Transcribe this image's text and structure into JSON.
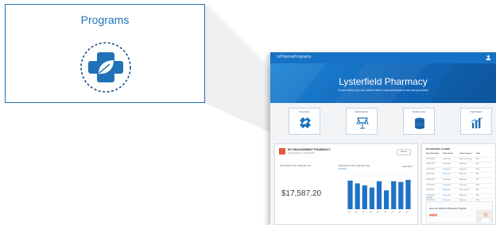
{
  "callout": {
    "title": "Programs",
    "icon": "programs-cross-icon"
  },
  "app": {
    "brand": "rxPharmaPrograms",
    "hero": {
      "title": "Lysterfield Pharmacy",
      "subtitle": "A place where you can submit claims, track performance and ask questions!"
    },
    "tiles": [
      {
        "label": "Programs",
        "icon": "programs-cross-icon"
      },
      {
        "label": "Medications",
        "icon": "scale-icon"
      },
      {
        "label": "Settlements",
        "icon": "coins-icon"
      },
      {
        "label": "Dashboard",
        "icon": "bar-chart-icon"
      }
    ],
    "pharmacy": {
      "name": "MY ENGAGEMENT PHARMACY",
      "address": "Lysterfield Rd, Lysterfield VIC",
      "button": "Details"
    },
    "stat": {
      "label": "Paid Claims This Calendar Year",
      "value": "$17,587.20"
    },
    "chart": {
      "title": "Paid Claims This Calendar Year",
      "subtitle": "By Month",
      "legend": "Paid Claims"
    },
    "claims": {
      "title": "MY RECENT CLAIMS",
      "columns": [
        "Date Submitted",
        "Claim Status",
        "Claim Program",
        "Total"
      ],
      "rows": [
        [
          "25/10/2023",
          "Submitted",
          "Medicine Usage",
          "$80"
        ],
        [
          "24/10/2023",
          "Submitted",
          "Medicine",
          "$54"
        ],
        [
          "24/10/2023",
          "Submitted",
          "Medicine",
          "$54"
        ],
        [
          "23/10/2023",
          "Submitted",
          "Medicine",
          "$54"
        ],
        [
          "23/10/2023",
          "Submitted",
          "Medicine",
          "$54"
        ],
        [
          "20/10/2023",
          "Submitted",
          "Medicine",
          "$54"
        ],
        [
          "19/10/2023",
          "Submitted",
          "Pulse Check",
          "$20"
        ],
        [
          "18/10/2023",
          "Submitted",
          "Medicine",
          "$54"
        ],
        [
          "18/10/2023",
          "Submitted",
          "Medicine",
          "$54"
        ]
      ],
      "more": "View all",
      "promo": "Have the 2023/24 Pharmacy Program"
    }
  },
  "chart_data": {
    "type": "bar",
    "categories": [
      "M1",
      "M2",
      "M3",
      "M4",
      "M5",
      "M6",
      "M7",
      "M8",
      "M9"
    ],
    "values": [
      2050,
      1850,
      1700,
      1550,
      2000,
      1350,
      2000,
      1950,
      2100
    ],
    "ylim": [
      0,
      2500
    ],
    "grid": true,
    "color": "#1f72c4"
  }
}
